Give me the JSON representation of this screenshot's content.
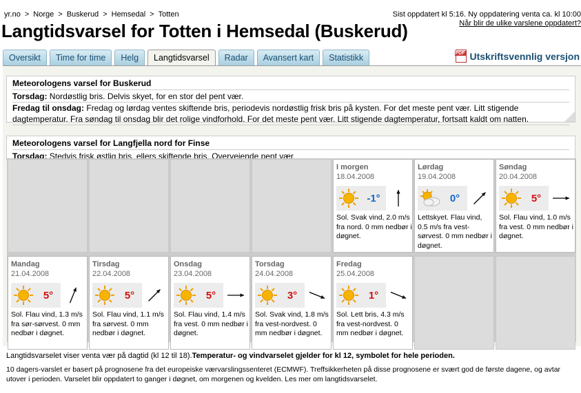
{
  "breadcrumb": [
    "yr.no",
    "Norge",
    "Buskerud",
    "Hemsedal",
    "Totten"
  ],
  "update_info": "Sist oppdatert kl 5:16. Ny oppdatering venta ca. kl 10:00",
  "update_link": "Når blir de ulike varslene oppdatert?",
  "title": "Langtidsvarsel for Totten i Hemsedal (Buskerud)",
  "tabs": [
    {
      "label": "Oversikt",
      "active": false
    },
    {
      "label": "Time for time",
      "active": false
    },
    {
      "label": "Helg",
      "active": false
    },
    {
      "label": "Langtidsvarsel",
      "active": true
    },
    {
      "label": "Radar",
      "active": false
    },
    {
      "label": "Avansert kart",
      "active": false
    },
    {
      "label": "Statistikk",
      "active": false
    }
  ],
  "print_label": "Utskriftsvennlig versjon",
  "forecast_buskerud": {
    "title": "Meteorologens varsel for Buskerud",
    "rows": [
      {
        "period": "Torsdag:",
        "text": "Nordøstlig bris. Delvis skyet, for en stor del pent vær."
      },
      {
        "period": "Fredag til onsdag:",
        "text": "Fredag og lørdag ventes skiftende bris, periodevis nordøstlig frisk bris på kysten. For det meste pent vær. Litt stigende dagtemperatur. Fra søndag til onsdag blir det rolige vindforhold. For det meste pent vær. Litt stigende dagtemperatur, fortsatt kaldt om natten."
      }
    ]
  },
  "forecast_langfjella": {
    "title": "Meteorologens varsel for Langfjella nord for Finse",
    "rows": [
      {
        "period": "Torsdag:",
        "text": "Stedvis frisk østlig bris, ellers skiftende bris. Overveiende pent vær."
      }
    ]
  },
  "days": [
    {
      "day": "I morgen",
      "date": "18.04.2008",
      "symbol": "sun-icon",
      "temp": "-1°",
      "temp_class": "cold",
      "wind_direction": "north",
      "desc": "Sol. Svak vind, 2.0 m/s fra nord. 0 mm nedbør i døgnet."
    },
    {
      "day": "Lørdag",
      "date": "19.04.2008",
      "symbol": "partly-cloudy-icon",
      "temp": "0°",
      "temp_class": "cold",
      "wind_direction": "southwest",
      "desc": "Lettskyet. Flau vind, 0.5 m/s fra vest-sørvest. 0 mm nedbør i døgnet."
    },
    {
      "day": "Søndag",
      "date": "20.04.2008",
      "symbol": "sun-icon",
      "temp": "5°",
      "temp_class": "warm",
      "wind_direction": "west",
      "desc": "Sol. Flau vind, 1.0 m/s fra vest. 0 mm nedbør i døgnet."
    },
    {
      "day": "Mandag",
      "date": "21.04.2008",
      "symbol": "sun-icon",
      "temp": "5°",
      "temp_class": "warm",
      "wind_direction": "south-southwest",
      "desc": "Sol. Flau vind, 1.3 m/s fra sør-sørvest. 0 mm nedbør i døgnet."
    },
    {
      "day": "Tirsdag",
      "date": "22.04.2008",
      "symbol": "sun-icon",
      "temp": "5°",
      "temp_class": "warm",
      "wind_direction": "southwest",
      "desc": "Sol. Flau vind, 1.1 m/s fra sørvest. 0 mm nedbør i døgnet."
    },
    {
      "day": "Onsdag",
      "date": "23.04.2008",
      "symbol": "sun-icon",
      "temp": "5°",
      "temp_class": "warm",
      "wind_direction": "west",
      "desc": "Sol. Flau vind, 1.4 m/s fra vest. 0 mm nedbør i døgnet."
    },
    {
      "day": "Torsdag",
      "date": "24.04.2008",
      "symbol": "sun-icon",
      "temp": "3°",
      "temp_class": "warm",
      "wind_direction": "west-northwest",
      "desc": "Sol. Svak vind, 1.8 m/s fra vest-nordvest. 0 mm nedbør i døgnet."
    },
    {
      "day": "Fredag",
      "date": "25.04.2008",
      "symbol": "sun-icon",
      "temp": "1°",
      "temp_class": "warm",
      "wind_direction": "west-northwest",
      "desc": "Sol. Lett bris, 4.3 m/s fra vest-nordvest. 0 mm nedbør i døgnet."
    }
  ],
  "footer_note": "Langtidsvarselet viser venta vær på dagtid (kl 12 til 18).",
  "footer_note_bold": "Temperatur- og vindvarselet gjelder for kl 12, symbolet for hele perioden.",
  "footer_info": "10 dagers-varslet er basert på prognosene fra det europeiske værvarslingssenteret (ECMWF). Treffsikkerheten på disse prognosene er svært god de første dagene, og avtar utover i perioden. Varselet blir oppdatert to ganger i døgnet, om morgenen og kvelden. Les mer om langtidsvarselet.",
  "colors": {
    "tab_text": "#1a4f73",
    "temp_warm": "#d01010",
    "temp_cold": "#1668c8",
    "panel_bg": "#f4f4ef"
  }
}
